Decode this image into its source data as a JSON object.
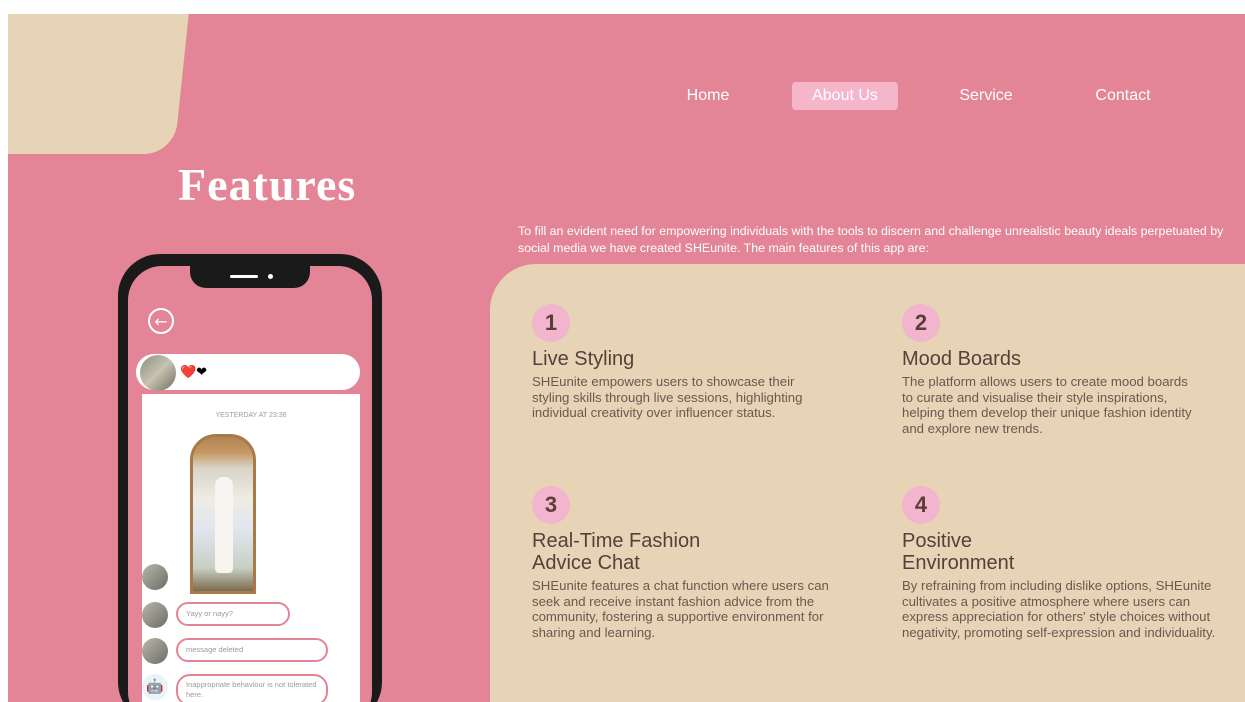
{
  "nav": {
    "items": [
      {
        "label": "Home",
        "active": false
      },
      {
        "label": "About Us",
        "active": true
      },
      {
        "label": "Service",
        "active": false
      },
      {
        "label": "Contact",
        "active": false
      }
    ]
  },
  "page": {
    "title": "Features",
    "intro": "To fill an evident need for empowering individuals with the tools to discern and challenge unrealistic beauty ideals perpetuated by social media we have created SHEunite. The main features of this app are:"
  },
  "features": [
    {
      "number": "1",
      "title": "Live Styling",
      "description": "SHEunite empowers users to showcase their styling skills through live sessions, highlighting individual creativity over influencer status."
    },
    {
      "number": "2",
      "title": "Mood Boards",
      "description": "The platform allows users to create mood boards to curate and visualise their style inspirations, helping them develop their unique fashion identity and explore new trends."
    },
    {
      "number": "3",
      "title": "Real-Time Fashion Advice Chat",
      "description": "SHEunite features a chat function where users can seek and receive instant fashion advice from the community, fostering a supportive environment for sharing and learning."
    },
    {
      "number": "4",
      "title": "Positive Environment",
      "description": "By refraining from including dislike options, SHEunite cultivates a positive atmosphere where users can express appreciation for others' style choices without negativity, promoting self-expression and individuality."
    }
  ],
  "phone": {
    "header_emojis": "❤️❤",
    "timestamp": "YESTERDAY AT 23:36",
    "messages": [
      {
        "text": "Yayy or nayy?"
      },
      {
        "text": "message deleted"
      },
      {
        "text": "Inappropriate behaviour is not tolerated here."
      }
    ],
    "icons": {
      "back": "back-arrow-icon",
      "robot": "robot-icon"
    }
  },
  "colors": {
    "background": "#e38596",
    "panel": "#e7d3b5",
    "accent": "#f3b4cd"
  }
}
